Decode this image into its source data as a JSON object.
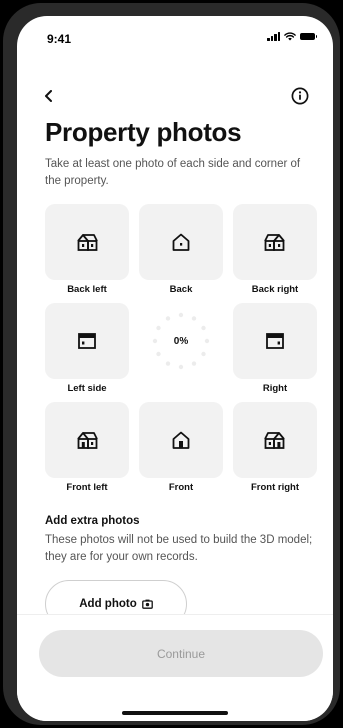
{
  "status_bar": {
    "time": "9:41"
  },
  "header": {
    "back_icon": "chevron-left-icon",
    "info_icon": "info-circle-icon",
    "title": "Property photos",
    "subtitle": "Take at least one photo of each side and corner of the property."
  },
  "photo_grid": {
    "tiles": [
      {
        "label": "Back left",
        "icon": "house-corner-icon"
      },
      {
        "label": "Back",
        "icon": "house-back-icon"
      },
      {
        "label": "Back right",
        "icon": "house-corner-icon"
      },
      {
        "label": "Left side",
        "icon": "wall-side-icon"
      },
      {
        "label": "Right",
        "icon": "wall-side-icon"
      },
      {
        "label": "Front left",
        "icon": "house-front-corner-icon"
      },
      {
        "label": "Front",
        "icon": "house-front-icon"
      },
      {
        "label": "Front right",
        "icon": "house-front-corner-icon"
      }
    ],
    "progress": {
      "label": "0%",
      "value": 0
    }
  },
  "extra_photos": {
    "title": "Add extra photos",
    "description": "These photos will not be used to build the 3D model; they are for your own records.",
    "add_button_label": "Add photo",
    "add_button_icon": "camera-icon"
  },
  "footer": {
    "continue_label": "Continue"
  },
  "colors": {
    "tile_bg": "#f2f2f2",
    "continue_bg": "#e5e5e5",
    "continue_text": "#9a9a9a"
  }
}
